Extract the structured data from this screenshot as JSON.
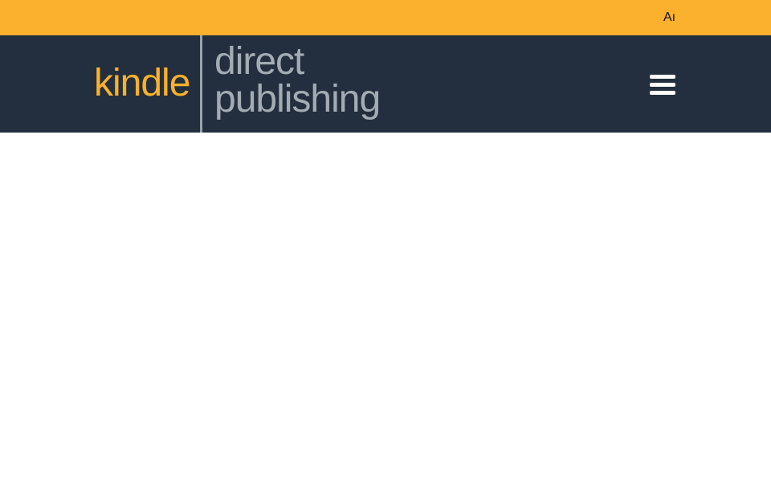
{
  "top_strip": {
    "text": "Aı"
  },
  "header": {
    "logo": {
      "word_kindle": "kindle",
      "word_direct": "direct",
      "word_publishing": "publishing"
    },
    "menu_icon": "hamburger-menu-icon"
  },
  "colors": {
    "top_strip_bg": "#fbb12d",
    "header_bg": "#232f3e",
    "logo_kindle": "#fbb12d",
    "logo_secondary": "#a3abb4",
    "page_bg": "#ffffff"
  }
}
